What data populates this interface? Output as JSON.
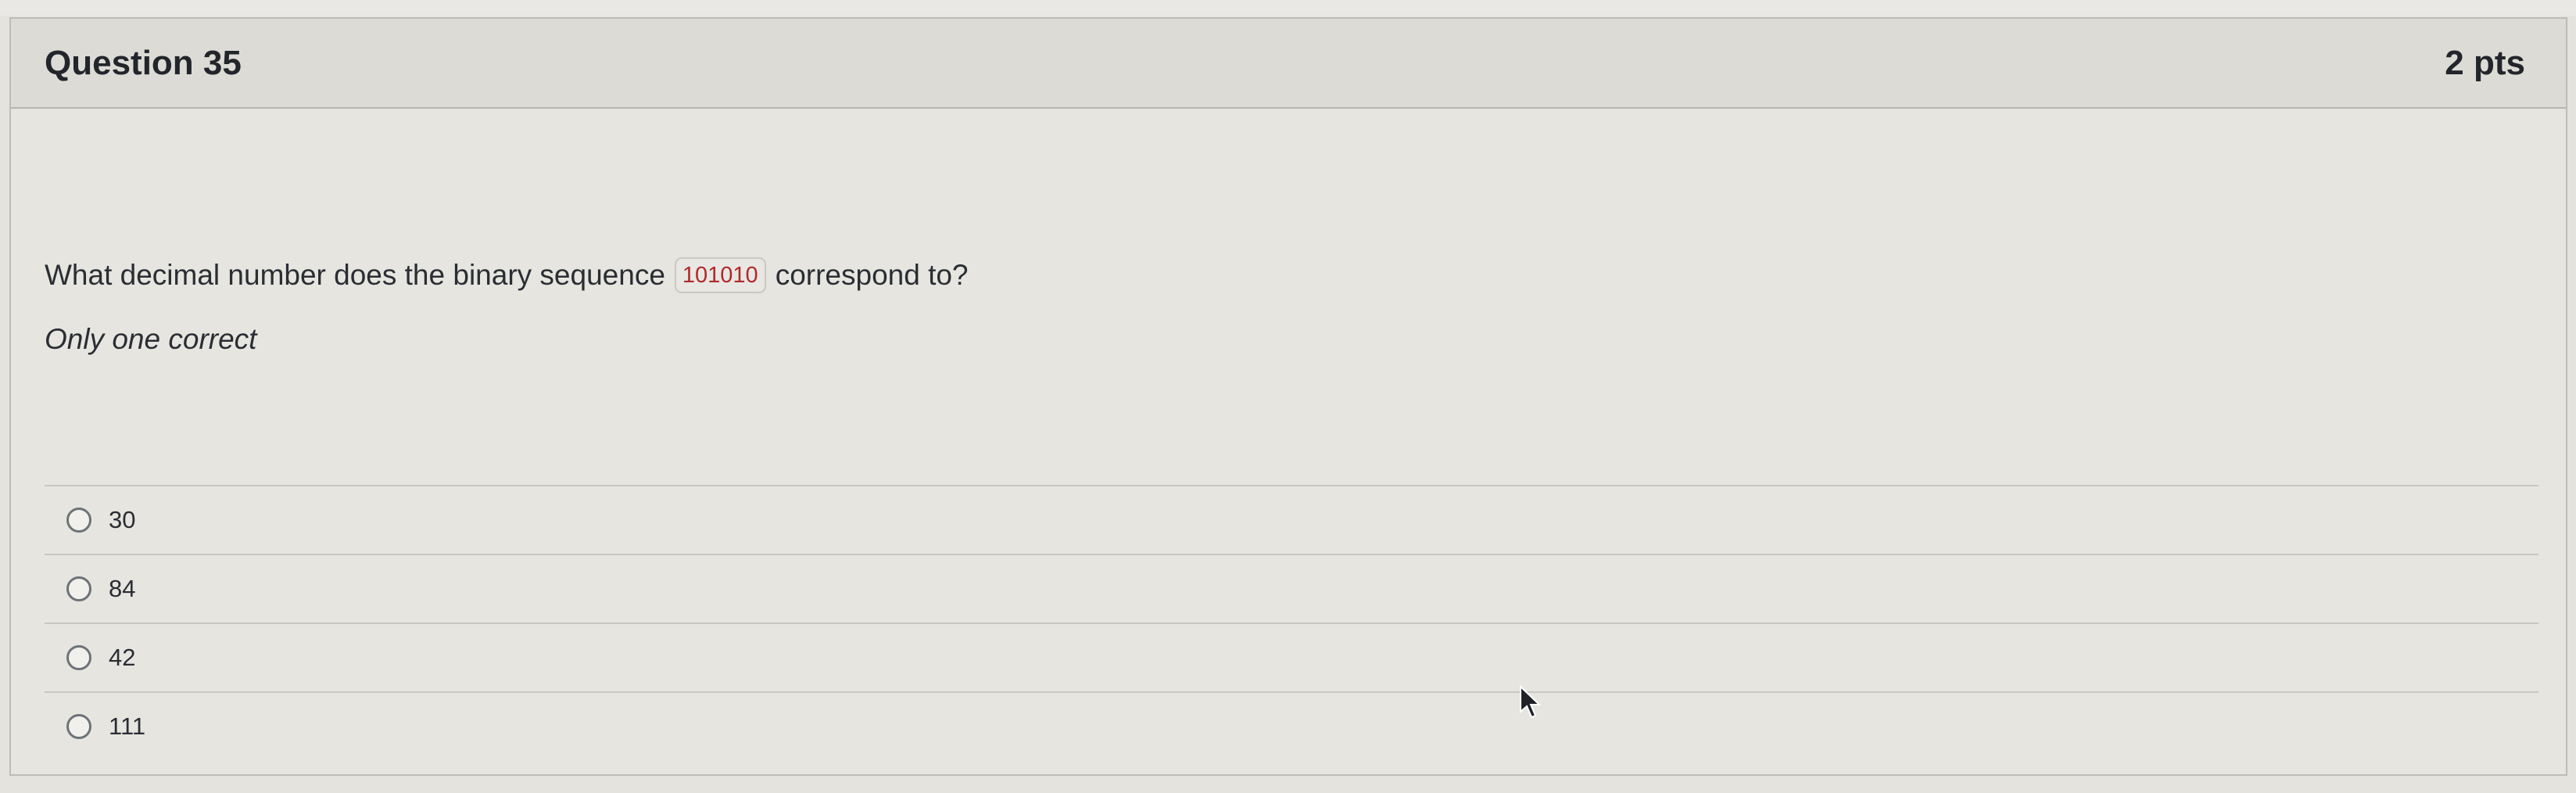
{
  "question": {
    "title": "Question 35",
    "points": "2 pts",
    "text_before": "What decimal number does the binary sequence",
    "binary_value": "101010",
    "text_after": "correspond to?",
    "note": "Only one correct"
  },
  "answers": [
    {
      "label": "30",
      "selected": false
    },
    {
      "label": "84",
      "selected": false
    },
    {
      "label": "42",
      "selected": false
    },
    {
      "label": "111",
      "selected": false
    }
  ],
  "colors": {
    "code_text": "#b02a2a",
    "header_background": "#dcdbd6",
    "card_background": "#e6e5e0"
  },
  "icons": {
    "cursor": "mouse-pointer-icon",
    "radio": "radio-button-icon"
  }
}
